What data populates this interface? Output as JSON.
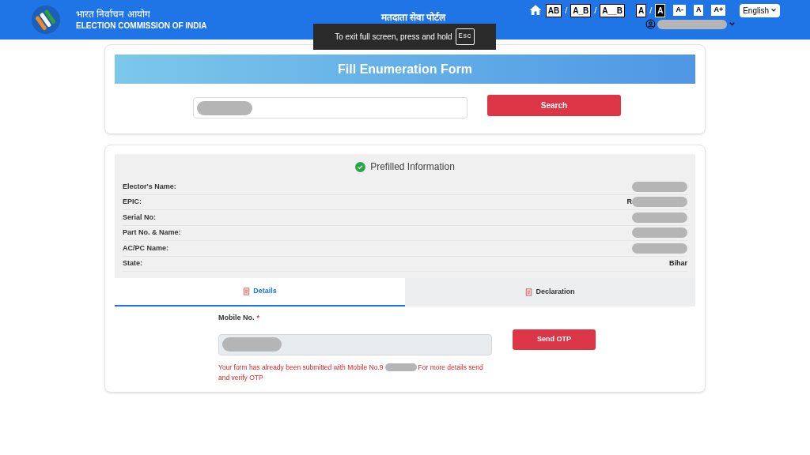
{
  "header": {
    "org_hindi": "भारत निर्वाचन आयोग",
    "org_english": "ELECTION COMMISSION OF INDIA",
    "portal_title": "मतदाता सेवा पोर्टल",
    "spacing_options": [
      {
        "label": "AB",
        "selected": false
      },
      {
        "label": "A_B",
        "selected": false
      },
      {
        "label": "A__B",
        "selected": false
      }
    ],
    "separator": "/",
    "contrast_options": [
      {
        "label": "A",
        "selected": false
      },
      {
        "label": "A",
        "selected": true
      }
    ],
    "size_options": [
      {
        "label": "A-"
      },
      {
        "label": "A"
      },
      {
        "label": "A+"
      }
    ],
    "language": "English",
    "user": {
      "redacted": true
    }
  },
  "toast": {
    "text": "To exit full screen, press and hold",
    "key": "Esc"
  },
  "search_card": {
    "title": "Fill Enumeration Form",
    "field": {
      "redacted": true
    },
    "button": "Search"
  },
  "prefilled": {
    "title": "Prefilled Information",
    "rows": [
      {
        "label": "Elector's Name:",
        "redacted": true
      },
      {
        "label": "EPIC:",
        "value": "R",
        "redacted": true
      },
      {
        "label": "Serial No:",
        "redacted": true
      },
      {
        "label": "Part No. & Name:",
        "redacted": true
      },
      {
        "label": "AC/PC Name:",
        "redacted": true
      },
      {
        "label": "State:",
        "value": "Bihar",
        "redacted": false
      }
    ]
  },
  "tabs": [
    {
      "label": "Details",
      "selected": true
    },
    {
      "label": "Declaration",
      "selected": false
    }
  ],
  "mobile": {
    "label": "Mobile No.",
    "required": true,
    "required_mark": "*",
    "redacted": true,
    "button": "Send OTP",
    "message_before": "Your form has already been submitted with Mobile No.9",
    "message_redacted": true,
    "message_after": "For more details send",
    "message_line2": "and verify OTP"
  }
}
